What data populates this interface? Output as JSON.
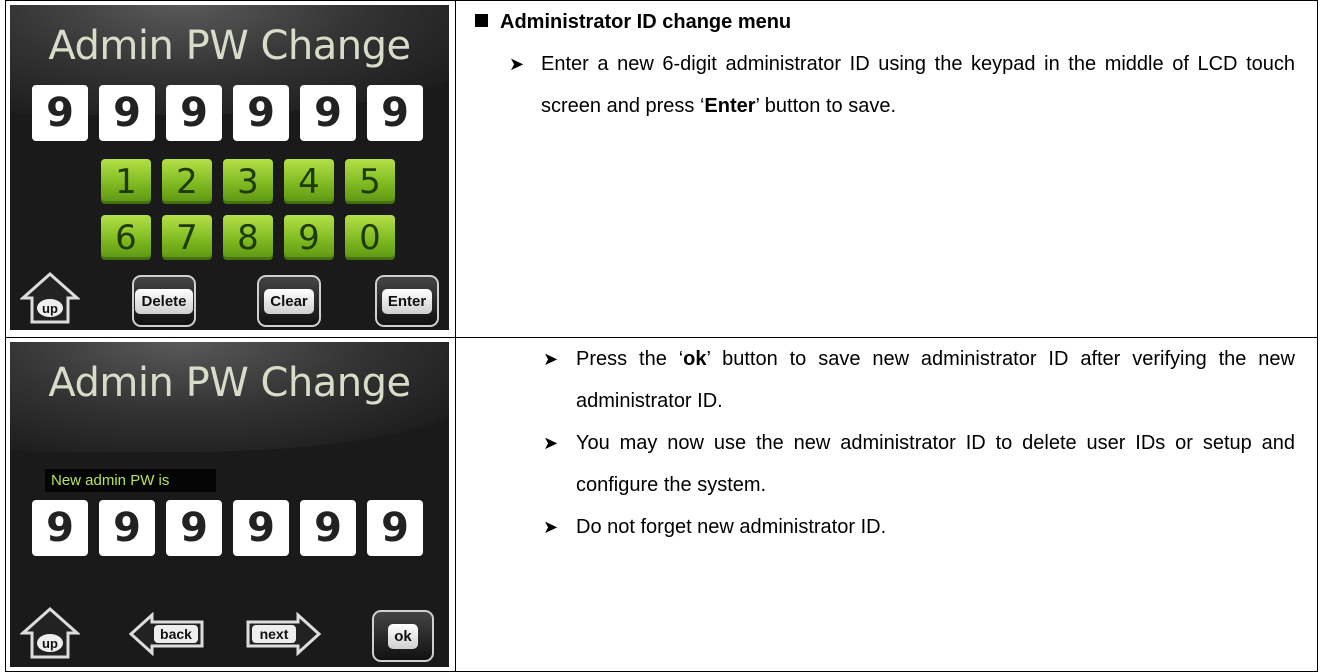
{
  "screen1": {
    "title": "Admin PW Change",
    "digits": [
      "9",
      "9",
      "9",
      "9",
      "9",
      "9"
    ],
    "keys_row1": [
      "1",
      "2",
      "3",
      "4",
      "5"
    ],
    "keys_row2": [
      "6",
      "7",
      "8",
      "9",
      "0"
    ],
    "up_label": "up",
    "delete_label": "Delete",
    "clear_label": "Clear",
    "enter_label": "Enter"
  },
  "screen2": {
    "title": "Admin PW Change",
    "banner": "New admin PW is",
    "digits": [
      "9",
      "9",
      "9",
      "9",
      "9",
      "9"
    ],
    "up_label": "up",
    "back_label": "back",
    "next_label": "next",
    "ok_label": "ok"
  },
  "section1": {
    "heading": "Administrator ID change menu",
    "bullet1_part1": "Enter a new 6-digit administrator ID using the keypad in the middle of LCD touch screen and press ‘",
    "bullet1_bold": "Enter",
    "bullet1_part2": "’ button to save."
  },
  "section2": {
    "bullet1_part1": "Press the ‘",
    "bullet1_bold": "ok",
    "bullet1_part2": "’ button to save new administrator ID after verifying the new administrator ID.",
    "bullet2": "You may now use the new administrator ID to delete user IDs or setup and configure the system.",
    "bullet3": "Do not forget new administrator ID."
  },
  "icons": {
    "bullet_square": "black-square",
    "bullet_arrow": "arrowhead-bullet"
  }
}
